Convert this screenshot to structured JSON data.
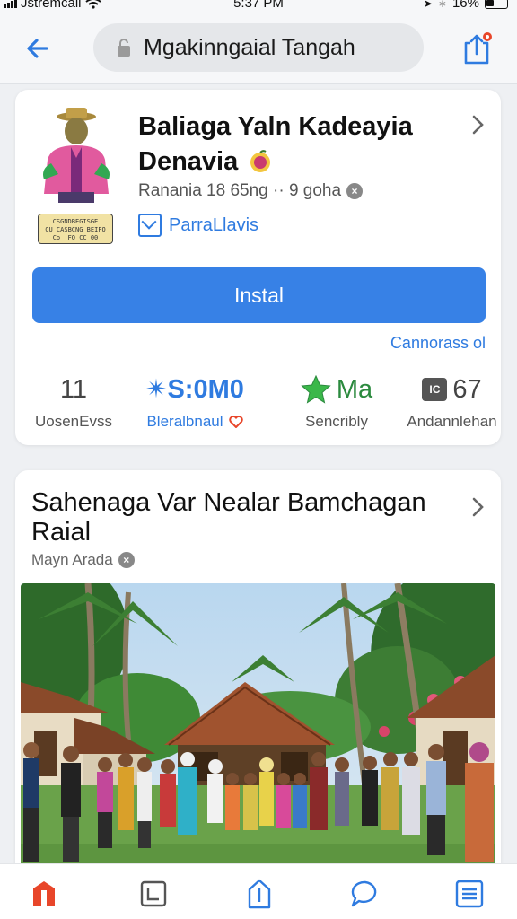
{
  "status_bar": {
    "carrier": "Jstremcall",
    "time": "5:37 PM",
    "battery": "16%"
  },
  "browser": {
    "url": "Mgakinngaial Tangah",
    "icons": [
      "back-arrow-icon",
      "lock-icon",
      "share-icon"
    ]
  },
  "app_card": {
    "title_line1": "Baliaga Yaln Kadeayia",
    "title_line2": "Denavia",
    "meta": "Ranania 18 65ng ·· 9 goha",
    "developer": "ParraLlavis",
    "badge_text": "CSGNDBEGISGE\nCU CASBCNG BEIFO\nCo  FO CC 00",
    "install_label": "Instal",
    "secondary_link": "Cannorass ol",
    "stats": [
      {
        "value": "11",
        "label": "UosenEvss"
      },
      {
        "value": "✴S:0M0",
        "label": "Bleralbnaul"
      },
      {
        "value": "Ma",
        "label": "Sencribly"
      },
      {
        "value": "67",
        "label": "Andannlehan"
      }
    ],
    "accent_color": "#3781e6"
  },
  "news_card": {
    "title": "Sahenaga Var Nealar Bamchagan Raial",
    "source": "Mayn Arada"
  },
  "bottom_nav": {
    "items": [
      "home-icon",
      "crop-icon",
      "upload-icon",
      "chat-icon",
      "menu-icon"
    ],
    "active_color": "#e8462a"
  }
}
